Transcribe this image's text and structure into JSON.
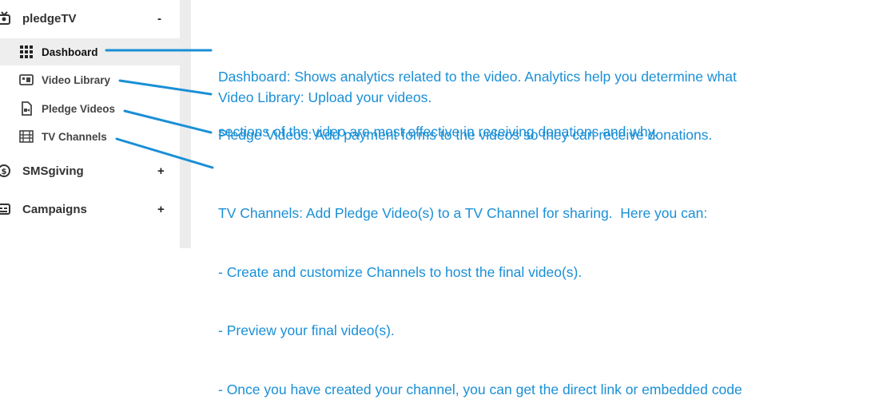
{
  "sidebar": {
    "sections": [
      {
        "label": "pledgeTV",
        "toggle": "-"
      },
      {
        "label": "SMSgiving",
        "toggle": "+"
      },
      {
        "label": "Campaigns",
        "toggle": "+"
      }
    ],
    "items": [
      {
        "label": "Dashboard"
      },
      {
        "label": "Video Library"
      },
      {
        "label": "Pledge Videos"
      },
      {
        "label": "TV Channels"
      }
    ]
  },
  "annotations": {
    "dashboard": [
      "Dashboard: Shows analytics related to the video. Analytics help you determine what",
      "sections of the video are most effective in receiving donations and why."
    ],
    "video_library": "Video Library: Upload your videos.",
    "pledge_videos": "Pledge Videos: Add payment forms to the videos so they can receive donations.",
    "tv_channels": [
      "TV Channels: Add Pledge Video(s) to a TV Channel for sharing.  Here you can:",
      "- Create and customize Channels to host the final video(s).",
      "- Preview your final video(s).",
      "- Once you have created your channel, you can get the direct link or embedded code"
    ]
  },
  "colors": {
    "annotation": "#1a8fd6",
    "sidebar_text": "#333333",
    "active_bg": "#eeeeee"
  }
}
